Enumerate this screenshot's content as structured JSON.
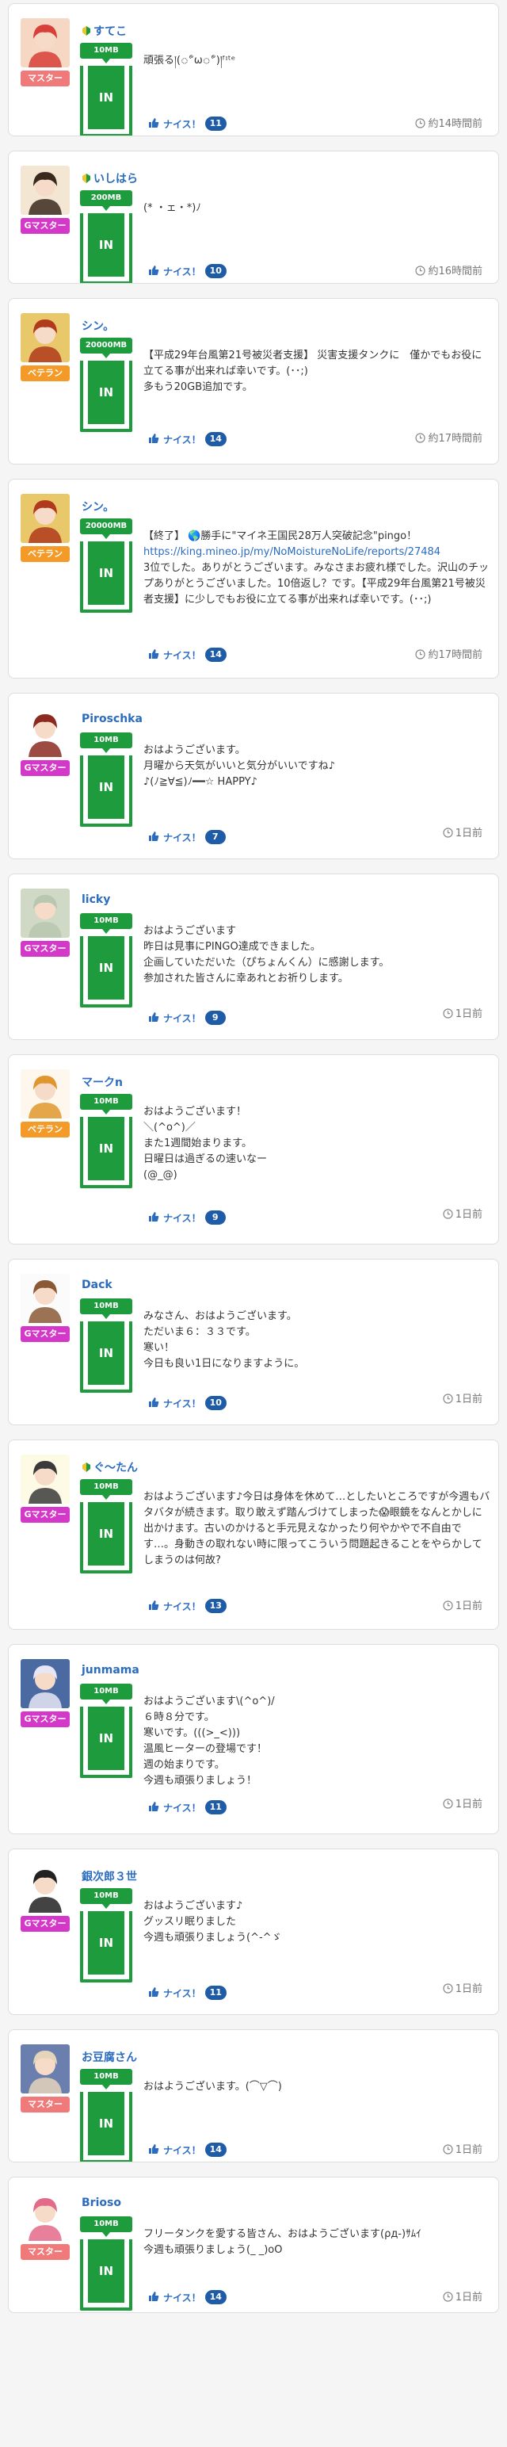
{
  "posts": [
    {
      "user": "すてこ",
      "beginner": true,
      "rank": "マスター",
      "rank_color": "#f07a7a",
      "gift": "10MB",
      "text": "頑張る།(ீωீ)།ᶠᶦᵗᵉ",
      "time": "約14時間前",
      "nice_label": "ナイス！",
      "nice": "11"
    },
    {
      "user": "いしはら",
      "beginner": true,
      "rank": "Gマスター",
      "rank_color": "#d338c9",
      "gift": "200MB",
      "text": "(* ・ェ・*)ﾉ",
      "time": "約16時間前",
      "nice_label": "ナイス！",
      "nice": "10"
    },
    {
      "user": "シン。",
      "beginner": false,
      "rank": "ベテラン",
      "rank_color": "#f39a28",
      "gift": "20000MB",
      "text": "【平成29年台風第21号被災者支援】 災害支援タンクに　僅かでもお役に立てる事が出来れば幸いです。(･･;)\n多もう20GB追加です。",
      "time": "約17時間前",
      "nice_label": "ナイス！",
      "nice": "14"
    },
    {
      "user": "シン。",
      "beginner": false,
      "rank": "ベテラン",
      "rank_color": "#f39a28",
      "gift": "20000MB",
      "text_pre": "【終了】 🌎勝手に\"マイネ王国民28万人突破記念\"pingo！\n",
      "link": "https://king.mineo.jp/my/NoMoistureNoLife/reports/27484",
      "text": "3位でした。ありがとうございます。みなさまお疲れ様でした。沢山のチップありがとうございました。10倍返し？です。【平成29年台風第21号被災者支援】に少しでもお役に立てる事が出来れば幸いです。(･･;)",
      "time": "約17時間前",
      "nice_label": "ナイス！",
      "nice": "14"
    },
    {
      "user": "Piroschka",
      "beginner": false,
      "rank": "Gマスター",
      "rank_color": "#d338c9",
      "gift": "10MB",
      "text": "おはようございます。\n月曜から天気がいいと気分がいいですね♪\n♪(ﾉ≧∀≦)ﾉ━━☆ HAPPY♪",
      "time": "1日前",
      "nice_label": "ナイス！",
      "nice": "7"
    },
    {
      "user": "licky",
      "beginner": false,
      "rank": "Gマスター",
      "rank_color": "#d338c9",
      "gift": "10MB",
      "text": "おはようございます\n昨日は見事にPINGO達成できました。\n企画していただいた（ぴちょんくん）に感謝します。\n参加された皆さんに幸あれとお祈りします。",
      "time": "1日前",
      "nice_label": "ナイス！",
      "nice": "9"
    },
    {
      "user": "マークn",
      "beginner": false,
      "rank": "ベテラン",
      "rank_color": "#f39a28",
      "gift": "10MB",
      "text": "おはようございます！\n＼(^o^)／\nまた1週間始まります。\n日曜日は過ぎるの速いなー\n(@_@)",
      "time": "1日前",
      "nice_label": "ナイス！",
      "nice": "9"
    },
    {
      "user": "Dack",
      "beginner": false,
      "rank": "Gマスター",
      "rank_color": "#d338c9",
      "gift": "10MB",
      "text": "みなさん、おはようございます。\nただいま６：３３です。\n寒い！\n今日も良い1日になりますように。",
      "time": "1日前",
      "nice_label": "ナイス！",
      "nice": "10"
    },
    {
      "user": "ぐ〜たん",
      "beginner": true,
      "rank": "Gマスター",
      "rank_color": "#d338c9",
      "gift": "10MB",
      "text": "おはようございます♪今日は身体を休めて…としたいところですが今週もバタバタが続きます。取り敢えず踏んづけてしまった😱眼鏡をなんとかしに出かけます。古いのかけると手元見えなかったり何やかやで不自由です…。身動きの取れない時に限ってこういう問題起きることをやらかしてしまうのは何故?",
      "time": "1日前",
      "nice_label": "ナイス！",
      "nice": "13"
    },
    {
      "user": "junmama",
      "beginner": false,
      "rank": "Gマスター",
      "rank_color": "#d338c9",
      "gift": "10MB",
      "text": "おはようございます\\(^o^)/\n６時８分です。\n寒いです。(((>_<)))\n温風ヒーターの登場です！\n週の始まりです。\n今週も頑張りましょう！",
      "time": "1日前",
      "nice_label": "ナイス！",
      "nice": "11"
    },
    {
      "user": "銀次郎３世",
      "beginner": false,
      "rank": "Gマスター",
      "rank_color": "#d338c9",
      "gift": "10MB",
      "text": "おはようございます♪\nグッスリ眠りました\n今週も頑張りましょう(^-^ゞ",
      "time": "1日前",
      "nice_label": "ナイス！",
      "nice": "11"
    },
    {
      "user": "お豆腐さん",
      "beginner": false,
      "rank": "マスター",
      "rank_color": "#f07a7a",
      "gift": "10MB",
      "text": "おはようございます。(⌒▽⌒)",
      "time": "1日前",
      "nice_label": "ナイス！",
      "nice": "14"
    },
    {
      "user": "Brioso",
      "beginner": false,
      "rank": "マスター",
      "rank_color": "#f07a7a",
      "gift": "10MB",
      "text": "フリータンクを愛する皆さん、おはようございます(ρд-)ｻﾑｲ\n今週も頑張りましょう(_ _)oO",
      "time": "1日前",
      "nice_label": "ナイス！",
      "nice": "14"
    }
  ]
}
